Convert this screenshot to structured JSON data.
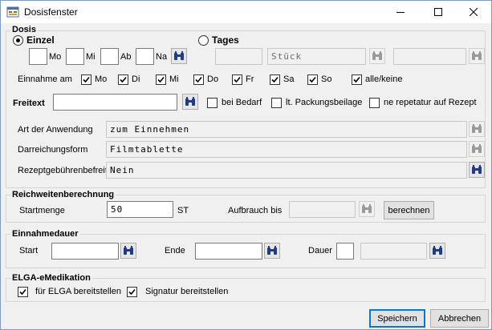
{
  "window": {
    "title": "Dosisfenster"
  },
  "dosis": {
    "legend": "Dosis",
    "einzel_label": "Einzel",
    "tages_label": "Tages",
    "times": [
      "Mo",
      "Mi",
      "Ab",
      "Na"
    ],
    "tages_unit_value": "Stück",
    "einnahme_label": "Einnahme am",
    "days": [
      "Mo",
      "Di",
      "Mi",
      "Do",
      "Fr",
      "Sa",
      "So"
    ],
    "all_none_label": "alle/keine",
    "freitext_label": "Freitext",
    "bei_bedarf_label": "bei Bedarf",
    "packungsbeilage_label": "lt. Packungsbeilage",
    "ne_repetatur_label": "ne repetatur auf Rezept",
    "anwendung_label": "Art der Anwendung",
    "anwendung_value": "zum Einnehmen",
    "darreichung_label": "Darreichungsform",
    "darreichung_value": "Filmtablette",
    "rezept_label": "Rezeptgebührenbefreit",
    "rezept_value": "Nein"
  },
  "reichweite": {
    "legend": "Reichweitenberechnung",
    "startmenge_label": "Startmenge",
    "startmenge_value": "50",
    "unit": "ST",
    "aufbrauch_label": "Aufbrauch bis",
    "berechnen_label": "berechnen"
  },
  "einnahmedauer": {
    "legend": "Einnahmedauer",
    "start_label": "Start",
    "ende_label": "Ende",
    "dauer_label": "Dauer"
  },
  "elga": {
    "legend": "ELGA-eMedikation",
    "bereitstellen_label": "für ELGA bereitstellen",
    "signatur_label": "Signatur bereitstellen"
  },
  "footer": {
    "save_label": "Speichern",
    "cancel_label": "Abbrechen"
  }
}
